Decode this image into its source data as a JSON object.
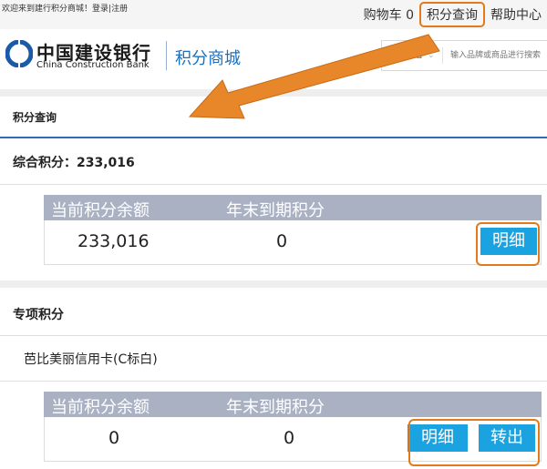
{
  "topbar": {
    "welcome": "欢迎来到建行积分商城！",
    "login": "登录",
    "separator": "|",
    "register": "注册",
    "cart": "购物车 0",
    "points_query": "积分查询",
    "help": "帮助中心"
  },
  "header": {
    "bank_name_cn": "中国建设银行",
    "bank_name_en": "China Construction Bank",
    "mall_title": "积分商城",
    "search_scope": "积分范围",
    "search_placeholder": "输入品牌或商品进行搜索"
  },
  "section": {
    "title": "积分查询"
  },
  "total": {
    "label": "综合积分：233,016"
  },
  "summary_table": {
    "col_balance": "当前积分余额",
    "col_expiring": "年末到期积分",
    "balance": "233,016",
    "expiring": "0",
    "detail_button": "明细"
  },
  "special": {
    "title": "专项积分",
    "card_name": "芭比美丽信用卡(C标白)",
    "col_balance": "当前积分余额",
    "col_expiring": "年末到期积分",
    "balance": "0",
    "expiring": "0",
    "detail_button": "明细",
    "transfer_button": "转出"
  },
  "colors": {
    "accent_blue": "#2e6bb3",
    "button_blue": "#1aa3e0",
    "header_gray": "#a9b1c3",
    "highlight_orange": "#e07a1a"
  }
}
